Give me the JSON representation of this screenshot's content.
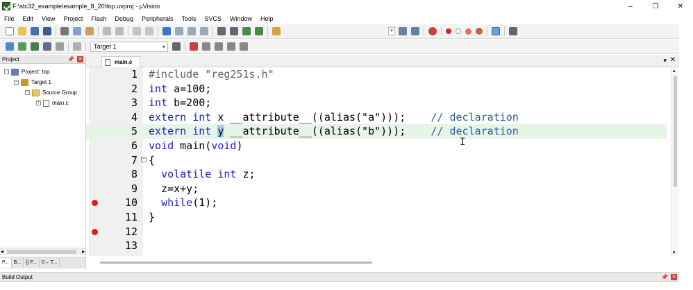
{
  "window": {
    "title": "F:\\stc32_example\\example_8_20\\top.uvproj - µVision",
    "minimize": "–",
    "maximize": "❐",
    "close": "✕"
  },
  "menu": [
    "File",
    "Edit",
    "View",
    "Project",
    "Flash",
    "Debug",
    "Peripherals",
    "Tools",
    "SVCS",
    "Window",
    "Help"
  ],
  "toolbar2": {
    "target_select": "Target 1"
  },
  "project_pane": {
    "title": "Project",
    "tree": [
      {
        "label": "Project: top",
        "toggle": "−",
        "icon": "project-icon"
      },
      {
        "label": "Target 1",
        "toggle": "−",
        "icon": "target-icon"
      },
      {
        "label": "Source Group",
        "toggle": "−",
        "icon": "folder-icon"
      },
      {
        "label": "main.c",
        "toggle": "+",
        "icon": "file-icon"
      }
    ],
    "tabs": [
      "P...",
      "B...",
      "{} F...",
      "0→ T..."
    ]
  },
  "editor": {
    "tab_label": "main.c",
    "lines": [
      {
        "n": "1",
        "bp": false,
        "hl": false,
        "fold": ""
      },
      {
        "n": "2",
        "bp": false,
        "hl": false,
        "fold": ""
      },
      {
        "n": "3",
        "bp": false,
        "hl": false,
        "fold": ""
      },
      {
        "n": "4",
        "bp": false,
        "hl": false,
        "fold": ""
      },
      {
        "n": "5",
        "bp": false,
        "hl": true,
        "fold": ""
      },
      {
        "n": "6",
        "bp": false,
        "hl": false,
        "fold": ""
      },
      {
        "n": "7",
        "bp": false,
        "hl": false,
        "fold": "−"
      },
      {
        "n": "8",
        "bp": false,
        "hl": false,
        "fold": ""
      },
      {
        "n": "9",
        "bp": false,
        "hl": false,
        "fold": ""
      },
      {
        "n": "10",
        "bp": true,
        "hl": false,
        "fold": ""
      },
      {
        "n": "11",
        "bp": false,
        "hl": false,
        "fold": ""
      },
      {
        "n": "12",
        "bp": true,
        "hl": false,
        "fold": ""
      },
      {
        "n": "13",
        "bp": false,
        "hl": false,
        "fold": ""
      }
    ],
    "code": {
      "l1_pp": "#include \"reg251s.h\"",
      "l2_kw": "int",
      "l2_rest": " a=100;",
      "l3_kw": "int",
      "l3_rest": " b=200;",
      "l4_kw1": "extern",
      "l4_kw2": "int",
      "l4_rest": " x __attribute__((alias(\"a\")));",
      "l4_cm": "// declaration",
      "l5_kw1": "extern",
      "l5_kw2": "int",
      "l5_sel": "y",
      "l5_rest": " __attribute__((alias(\"b\")));",
      "l5_cm": "// declaration",
      "l6_kw1": "void",
      "l6_mid": " main(",
      "l6_kw2": "void",
      "l6_end": ")",
      "l7": "{",
      "l8_kw1": "volatile",
      "l8_kw2": "int",
      "l8_rest": " z;",
      "l9": "z=x+y;",
      "l10_kw": "while",
      "l10_rest": "(1);",
      "l11": "}"
    }
  },
  "build_output": {
    "title": "Build Output"
  }
}
